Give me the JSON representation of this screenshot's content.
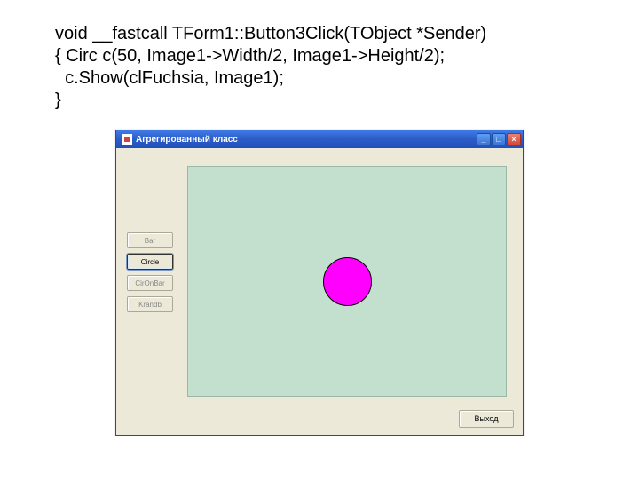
{
  "code": {
    "line1": "void __fastcall TForm1::Button3Click(TObject *Sender)",
    "line2": "{ Circ c(50, Image1->Width/2, Image1->Height/2);",
    "line3": "  c.Show(clFuchsia, Image1);",
    "line4": "}"
  },
  "window": {
    "title": "Агрегированный класс",
    "min": "_",
    "max": "□",
    "close": "×"
  },
  "buttons": {
    "b1": "Bar",
    "b2": "Circle",
    "b3": "CirOnBar",
    "b4": "Krandb"
  },
  "exit": "Выход"
}
